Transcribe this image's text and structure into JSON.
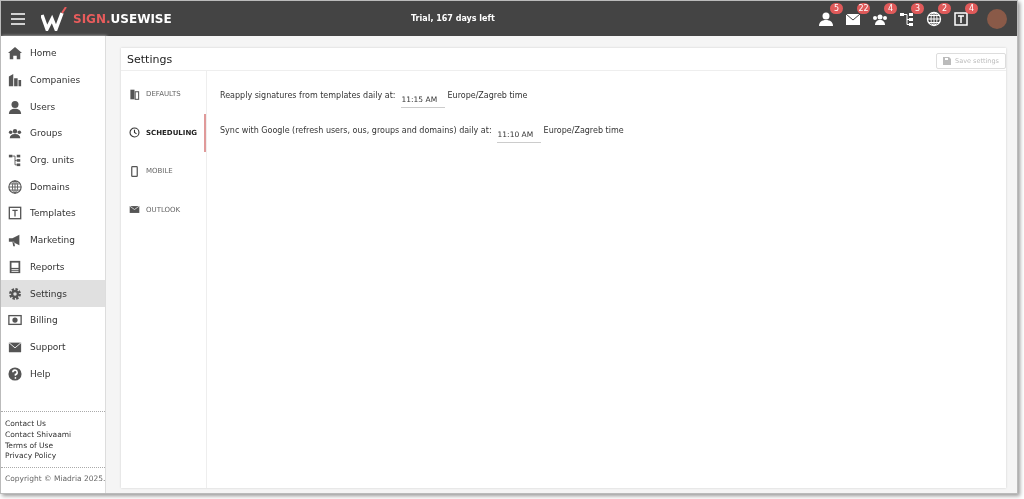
{
  "header": {
    "logo_prefix": "SIGN.",
    "logo_suffix": "USEWISE",
    "trial": "Trial, 167 days left",
    "notifications": [
      {
        "count": "5"
      },
      {
        "count": "22"
      },
      {
        "count": "4"
      },
      {
        "count": "3"
      },
      {
        "count": "2"
      },
      {
        "count": "4"
      }
    ]
  },
  "sidebar": {
    "items": [
      {
        "label": "Home",
        "selected": false
      },
      {
        "label": "Companies",
        "selected": false
      },
      {
        "label": "Users",
        "selected": false
      },
      {
        "label": "Groups",
        "selected": false
      },
      {
        "label": "Org. units",
        "selected": false
      },
      {
        "label": "Domains",
        "selected": false
      },
      {
        "label": "Templates",
        "selected": false
      },
      {
        "label": "Marketing",
        "selected": false
      },
      {
        "label": "Reports",
        "selected": false
      },
      {
        "label": "Settings",
        "selected": true
      },
      {
        "label": "Billing",
        "selected": false
      },
      {
        "label": "Support",
        "selected": false
      },
      {
        "label": "Help",
        "selected": false
      }
    ],
    "links": [
      "Contact Us",
      "Contact Shivaami",
      "Terms of Use",
      "Privacy Policy"
    ],
    "copyright": "Copyright © Miadria 2025."
  },
  "page": {
    "title": "Settings",
    "save_button": {
      "label": "Save settings",
      "disabled": true
    },
    "tabs": [
      {
        "label": "DEFAULTS",
        "selected": false
      },
      {
        "label": "SCHEDULING",
        "selected": true
      },
      {
        "label": "MOBILE",
        "selected": false
      },
      {
        "label": "OUTLOOK",
        "selected": false
      }
    ],
    "rows": [
      {
        "label": "Reapply signatures from templates daily at:",
        "value": "11:15 AM",
        "zone": "Europe/Zagreb time"
      },
      {
        "label": "Sync with Google (refresh users, ous, groups and domains) daily at:",
        "value": "11:10 AM",
        "zone": "Europe/Zagreb time"
      }
    ]
  }
}
